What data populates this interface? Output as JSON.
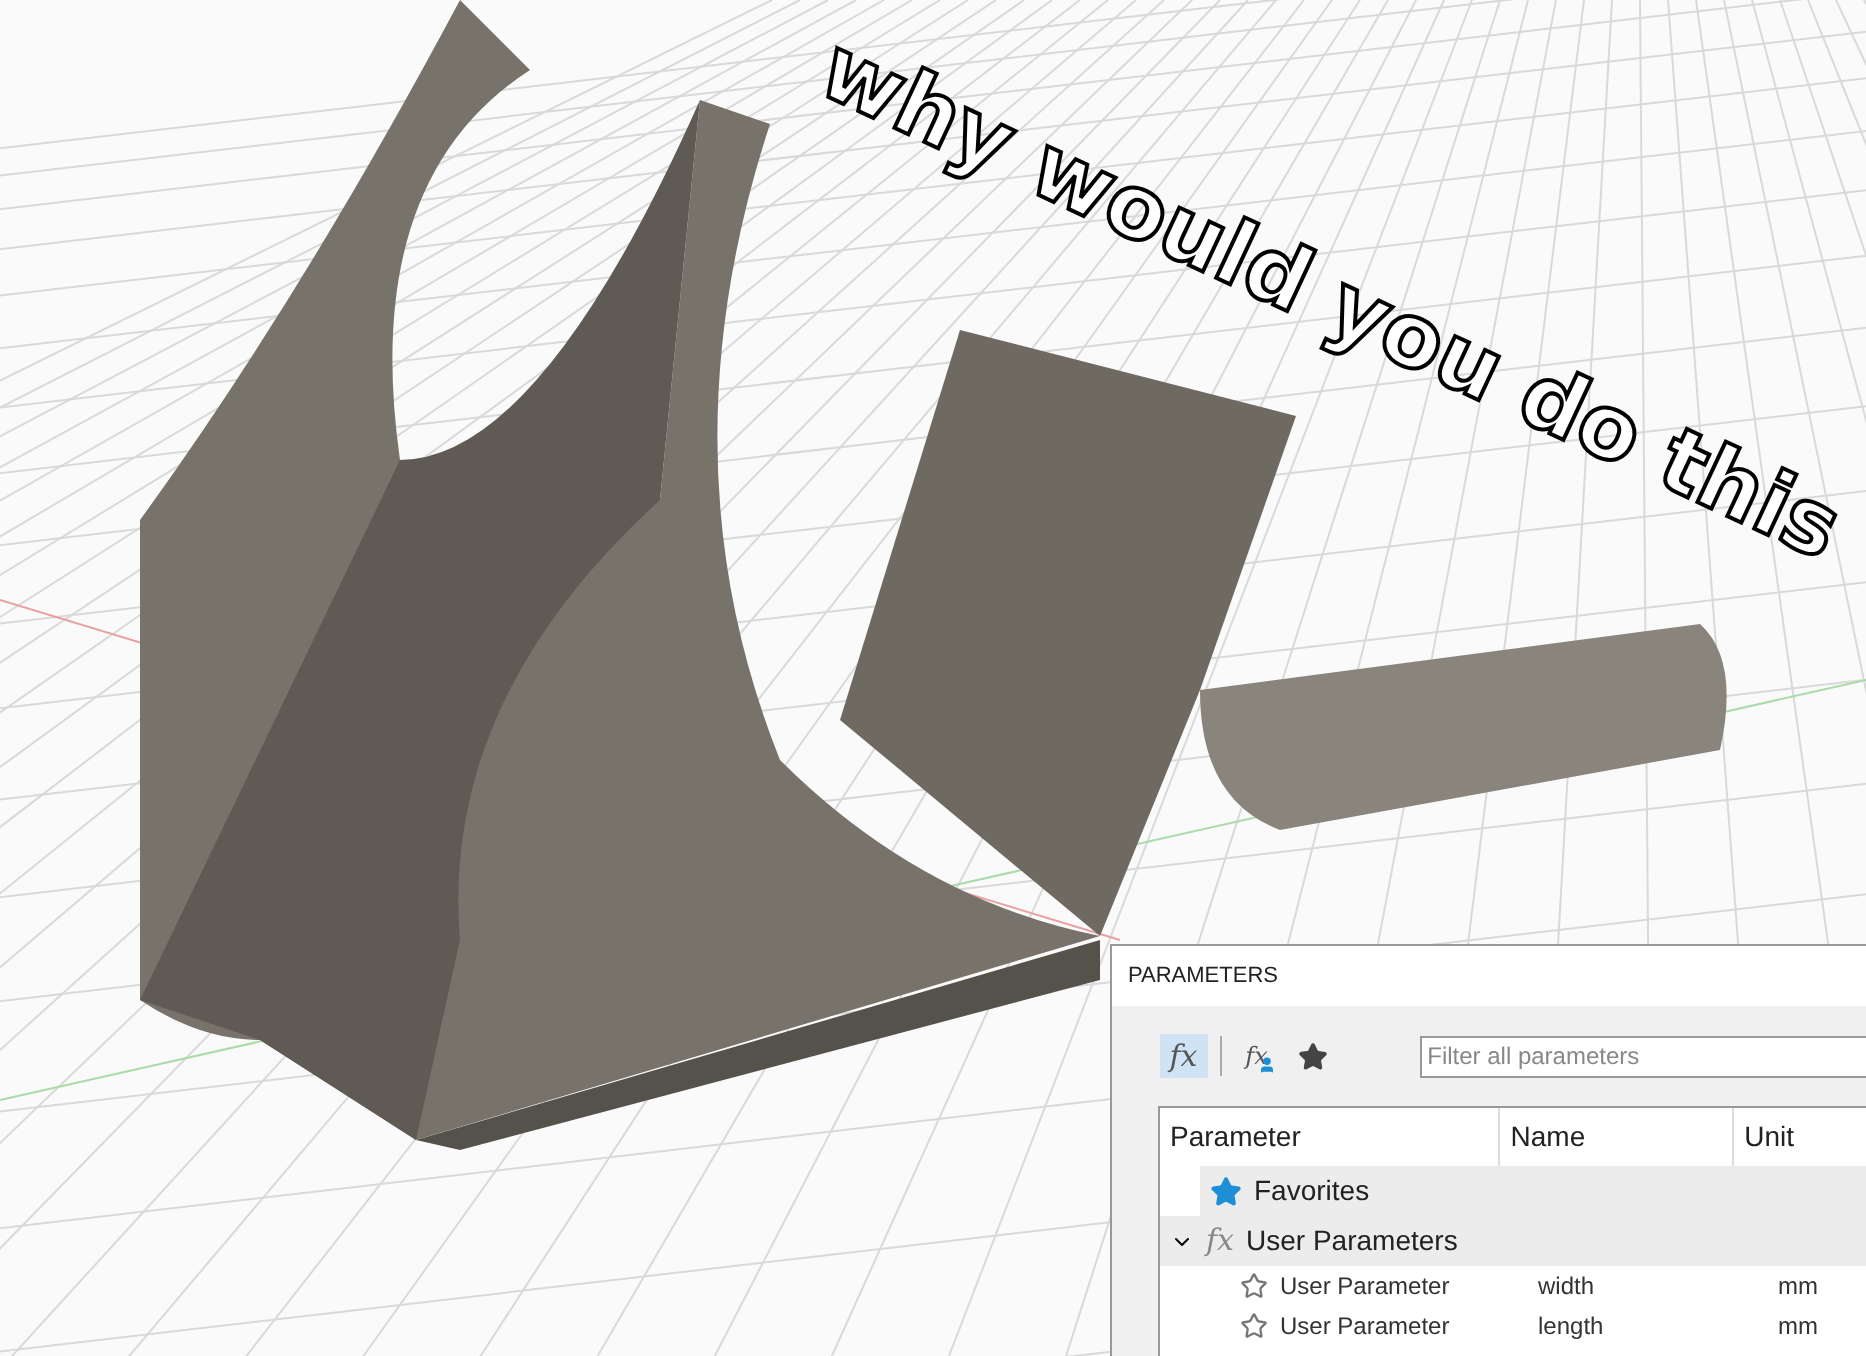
{
  "caption": "why would you do this",
  "panel": {
    "title": "PARAMETERS",
    "toolbar": [
      {
        "kind": "all",
        "glyph": "fx",
        "selected": true
      },
      {
        "kind": "user",
        "glyph": "fx",
        "selected": false
      },
      {
        "kind": "favorites",
        "selected": false
      }
    ],
    "search": {
      "placeholder": "Filter all parameters"
    },
    "table": {
      "columns": [
        "Parameter",
        "Name",
        "Unit"
      ],
      "rows": [
        {
          "kind": "favorites",
          "label": "Favorites"
        },
        {
          "kind": "group",
          "glyph": "fx",
          "label": "User Parameters",
          "expanded": true,
          "children": [
            {
              "kind": "param",
              "parameter": "User Parameter",
              "name": "width",
              "unit": "mm",
              "favorite": false
            },
            {
              "kind": "param",
              "parameter": "User Parameter",
              "name": "length",
              "unit": "mm",
              "favorite": false
            }
          ]
        }
      ]
    }
  }
}
